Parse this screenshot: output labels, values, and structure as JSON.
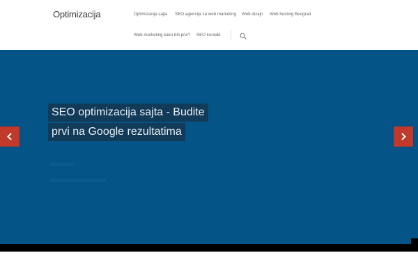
{
  "site": {
    "logo": "Optimizacija"
  },
  "nav": {
    "items": [
      {
        "label": "Optimizacija sajta"
      },
      {
        "label": "SEO agencija za web marketing"
      },
      {
        "label": "Web dizajn"
      },
      {
        "label": "Web hosting Beograd"
      },
      {
        "label": "Web marketing kako biti prvi?"
      },
      {
        "label": "SEO kontakt"
      }
    ],
    "search_icon": "search-icon"
  },
  "hero": {
    "caption_line1": "SEO optimizacija sajta - Budite",
    "caption_line2": "prvi na Google rezultatima",
    "prev_icon": "chevron-left-icon",
    "next_icon": "chevron-right-icon"
  },
  "colors": {
    "hero_bg": "#055487",
    "caption_bg": "#123b5a",
    "arrow_bg": "#c0392b"
  }
}
